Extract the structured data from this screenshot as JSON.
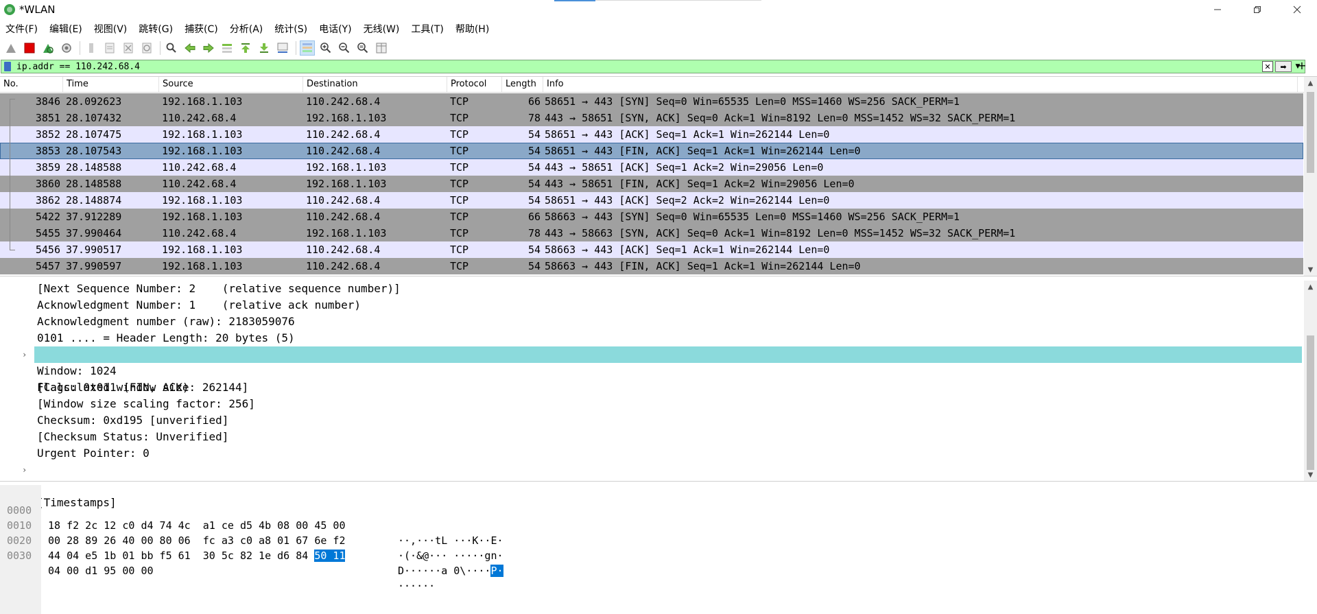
{
  "window": {
    "title": "*WLAN",
    "minimize_label": "–",
    "maximize_label": "❐",
    "close_label": "✕"
  },
  "menu": [
    {
      "label": "文件(F)"
    },
    {
      "label": "编辑(E)"
    },
    {
      "label": "视图(V)"
    },
    {
      "label": "跳转(G)"
    },
    {
      "label": "捕获(C)"
    },
    {
      "label": "分析(A)"
    },
    {
      "label": "统计(S)"
    },
    {
      "label": "电话(Y)"
    },
    {
      "label": "无线(W)"
    },
    {
      "label": "工具(T)"
    },
    {
      "label": "帮助(H)"
    }
  ],
  "toolbar_icons": [
    "shark-fin-start-icon",
    "stop-capture-icon",
    "restart-capture-icon",
    "capture-options-icon",
    "open-file-icon",
    "save-file-icon",
    "close-file-icon",
    "reload-file-icon",
    "find-packet-icon",
    "go-back-icon",
    "go-forward-icon",
    "go-to-packet-icon",
    "first-packet-icon",
    "last-packet-icon",
    "autoscroll-icon",
    "colorize-icon",
    "zoom-in-icon",
    "zoom-out-icon",
    "zoom-reset-icon",
    "resize-columns-icon"
  ],
  "filter": {
    "value": "ip.addr == 110.242.68.4",
    "add_label": "+"
  },
  "columns": {
    "no": "No.",
    "time": "Time",
    "source": "Source",
    "destination": "Destination",
    "protocol": "Protocol",
    "length": "Length",
    "info": "Info"
  },
  "packets": [
    {
      "no": "3846",
      "time": "28.092623",
      "src": "192.168.1.103",
      "dst": "110.242.68.4",
      "proto": "TCP",
      "len": "66",
      "info": "58651 → 443 [SYN] Seq=0 Win=65535 Len=0 MSS=1460 WS=256 SACK_PERM=1",
      "style": "gray"
    },
    {
      "no": "3851",
      "time": "28.107432",
      "src": "110.242.68.4",
      "dst": "192.168.1.103",
      "proto": "TCP",
      "len": "78",
      "info": "443 → 58651 [SYN, ACK] Seq=0 Ack=1 Win=8192 Len=0 MSS=1452 WS=32 SACK_PERM=1",
      "style": "gray"
    },
    {
      "no": "3852",
      "time": "28.107475",
      "src": "192.168.1.103",
      "dst": "110.242.68.4",
      "proto": "TCP",
      "len": "54",
      "info": "58651 → 443 [ACK] Seq=1 Ack=1 Win=262144 Len=0",
      "style": "lavender"
    },
    {
      "no": "3853",
      "time": "28.107543",
      "src": "192.168.1.103",
      "dst": "110.242.68.4",
      "proto": "TCP",
      "len": "54",
      "info": "58651 → 443 [FIN, ACK] Seq=1 Ack=1 Win=262144 Len=0",
      "style": "selected"
    },
    {
      "no": "3859",
      "time": "28.148588",
      "src": "110.242.68.4",
      "dst": "192.168.1.103",
      "proto": "TCP",
      "len": "54",
      "info": "443 → 58651 [ACK] Seq=1 Ack=2 Win=29056 Len=0",
      "style": "lavender"
    },
    {
      "no": "3860",
      "time": "28.148588",
      "src": "110.242.68.4",
      "dst": "192.168.1.103",
      "proto": "TCP",
      "len": "54",
      "info": "443 → 58651 [FIN, ACK] Seq=1 Ack=2 Win=29056 Len=0",
      "style": "gray"
    },
    {
      "no": "3862",
      "time": "28.148874",
      "src": "192.168.1.103",
      "dst": "110.242.68.4",
      "proto": "TCP",
      "len": "54",
      "info": "58651 → 443 [ACK] Seq=2 Ack=2 Win=262144 Len=0",
      "style": "lavender"
    },
    {
      "no": "5422",
      "time": "37.912289",
      "src": "192.168.1.103",
      "dst": "110.242.68.4",
      "proto": "TCP",
      "len": "66",
      "info": "58663 → 443 [SYN] Seq=0 Win=65535 Len=0 MSS=1460 WS=256 SACK_PERM=1",
      "style": "gray"
    },
    {
      "no": "5455",
      "time": "37.990464",
      "src": "110.242.68.4",
      "dst": "192.168.1.103",
      "proto": "TCP",
      "len": "78",
      "info": "443 → 58663 [SYN, ACK] Seq=0 Ack=1 Win=8192 Len=0 MSS=1452 WS=32 SACK_PERM=1",
      "style": "gray"
    },
    {
      "no": "5456",
      "time": "37.990517",
      "src": "192.168.1.103",
      "dst": "110.242.68.4",
      "proto": "TCP",
      "len": "54",
      "info": "58663 → 443 [ACK] Seq=1 Ack=1 Win=262144 Len=0",
      "style": "lavender"
    },
    {
      "no": "5457",
      "time": "37.990597",
      "src": "192.168.1.103",
      "dst": "110.242.68.4",
      "proto": "TCP",
      "len": "54",
      "info": "58663 → 443 [FIN, ACK] Seq=1 Ack=1 Win=262144 Len=0",
      "style": "gray"
    }
  ],
  "details": [
    {
      "text": "[Next Sequence Number: 2    (relative sequence number)]"
    },
    {
      "text": "Acknowledgment Number: 1    (relative ack number)"
    },
    {
      "text": "Acknowledgment number (raw): 2183059076"
    },
    {
      "text": "0101 .... = Header Length: 20 bytes (5)"
    },
    {
      "text": "Flags: 0x011 (FIN, ACK)",
      "expander": "›",
      "highlight": true
    },
    {
      "text": "Window: 1024"
    },
    {
      "text": "[Calculated window size: 262144]"
    },
    {
      "text": "[Window size scaling factor: 256]"
    },
    {
      "text": "Checksum: 0xd195 [unverified]"
    },
    {
      "text": "[Checksum Status: Unverified]"
    },
    {
      "text": "Urgent Pointer: 0"
    },
    {
      "text": "[Timestamps]",
      "expander": "›"
    }
  ],
  "bytes": [
    {
      "offset": "0000",
      "hex": "18 f2 2c 12 c0 d4 74 4c  a1 ce d5 4b 08 00 45 00",
      "hex_sel": "",
      "ascii": "··,···tL ···K··E·",
      "ascii_sel": ""
    },
    {
      "offset": "0010",
      "hex": "00 28 89 26 40 00 80 06  fc a3 c0 a8 01 67 6e f2",
      "hex_sel": "",
      "ascii": "·(·&@··· ·····gn·",
      "ascii_sel": ""
    },
    {
      "offset": "0020",
      "hex": "44 04 e5 1b 01 bb f5 61  30 5c 82 1e d6 84 ",
      "hex_sel": "50 11",
      "ascii": "D······a 0\\····",
      "ascii_sel": "P·"
    },
    {
      "offset": "0030",
      "hex": "04 00 d1 95 00 00",
      "hex_sel": "",
      "ascii": "······",
      "ascii_sel": ""
    }
  ]
}
